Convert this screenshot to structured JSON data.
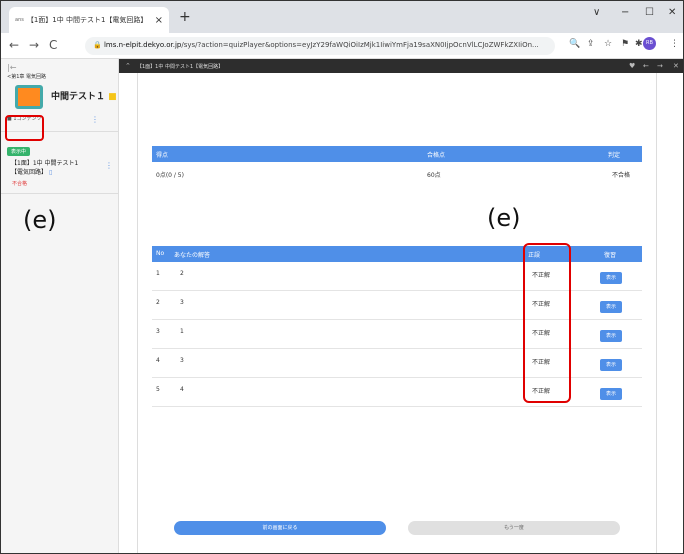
{
  "browser": {
    "tab_favicon": "ans",
    "tab_title": "【1面】1中 中間テスト1【電気回路】",
    "tab_close": "×",
    "new_tab": "+",
    "window_controls": [
      "∨",
      "−",
      "☐",
      "✕"
    ],
    "url_host": "lms.n-elpit.dekyo.or.jp",
    "url_path": "/sys/?action=quizPlayer&options=eyJzY29faWQiOiIzMjk1IiwiYmFja19saXN0IjpOcnVlLCJoZWFkZXIiOn...",
    "avatar_text": "RB"
  },
  "sidebar": {
    "back": "|←",
    "chapter": "<第1章 電気回路",
    "course_title": "中間テスト１",
    "contents_label": "■ 1コンテンツ",
    "badge": "表示中",
    "item_line1": "【1面】1中 中間テスト1",
    "item_line2": "【電気回路】",
    "item_status": "不合格"
  },
  "annotations": {
    "left_label": "(e)",
    "right_label": "(e)"
  },
  "player": {
    "title": "【1面】1中 中間テスト1【電気回路】"
  },
  "score_table": {
    "headers": [
      "得点",
      "合格点",
      "判定"
    ],
    "score": "0点(0 / 5)",
    "pass_score": "60点",
    "result": "不合格"
  },
  "answer_table": {
    "headers": [
      "No",
      "あなたの解答",
      "正誤",
      "復習"
    ],
    "rows": [
      {
        "no": "1",
        "answer": "2",
        "correct": "不正解",
        "review": "表示"
      },
      {
        "no": "2",
        "answer": "3",
        "correct": "不正解",
        "review": "表示"
      },
      {
        "no": "3",
        "answer": "1",
        "correct": "不正解",
        "review": "表示"
      },
      {
        "no": "4",
        "answer": "3",
        "correct": "不正解",
        "review": "表示"
      },
      {
        "no": "5",
        "answer": "4",
        "correct": "不正解",
        "review": "表示"
      }
    ]
  },
  "buttons": {
    "back": "前の画面に戻る",
    "retry": "もう一度"
  }
}
